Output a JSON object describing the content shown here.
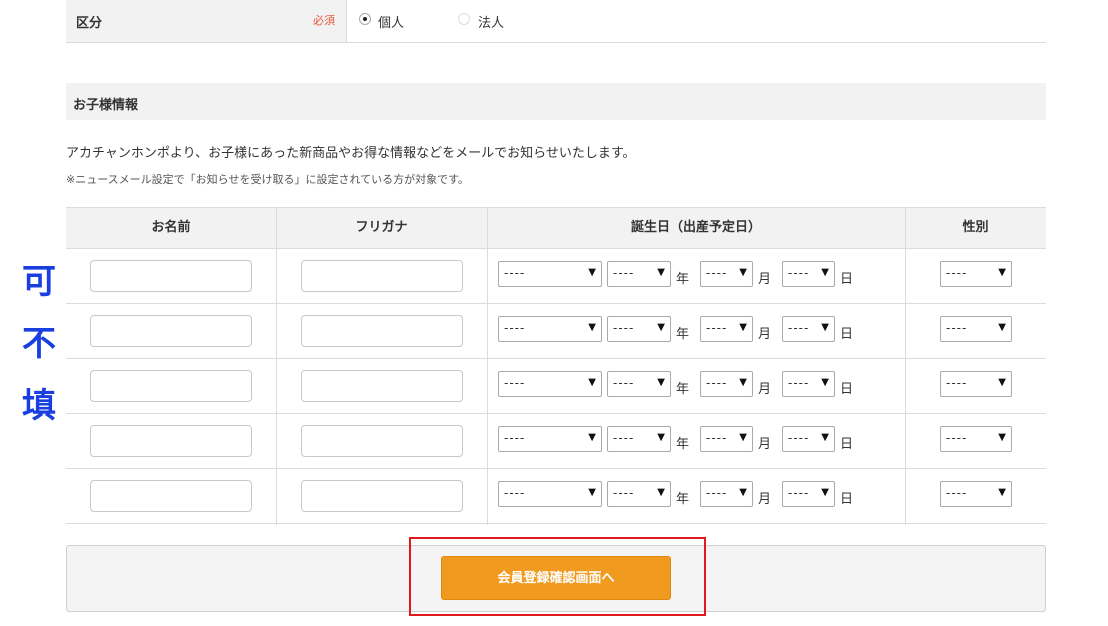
{
  "kubun": {
    "label": "区分",
    "required": "必須",
    "options": [
      {
        "label": "個人",
        "checked": true
      },
      {
        "label": "法人",
        "checked": false
      }
    ]
  },
  "children_section": {
    "title": "お子様情報",
    "description": "アカチャンホンポより、お子様にあった新商品やお得な情報などをメールでお知らせいたします。",
    "note": "※ニュースメール設定で「お知らせを受け取る」に設定されている方が対象です。"
  },
  "table": {
    "headers": [
      "お名前",
      "フリガナ",
      "誕生日（出産予定日）",
      "性別"
    ],
    "select_placeholder": "----",
    "year_label": "年",
    "month_label": "月",
    "day_label": "日",
    "row_count": 5
  },
  "side_note": [
    "可",
    "不",
    "填"
  ],
  "submit": {
    "label": "会員登録確認画面へ"
  },
  "colors": {
    "accent_button": "#f09a1f",
    "side_note": "#1a3fe0",
    "highlight_frame": "#e0191f",
    "required": "#e05a3a"
  }
}
